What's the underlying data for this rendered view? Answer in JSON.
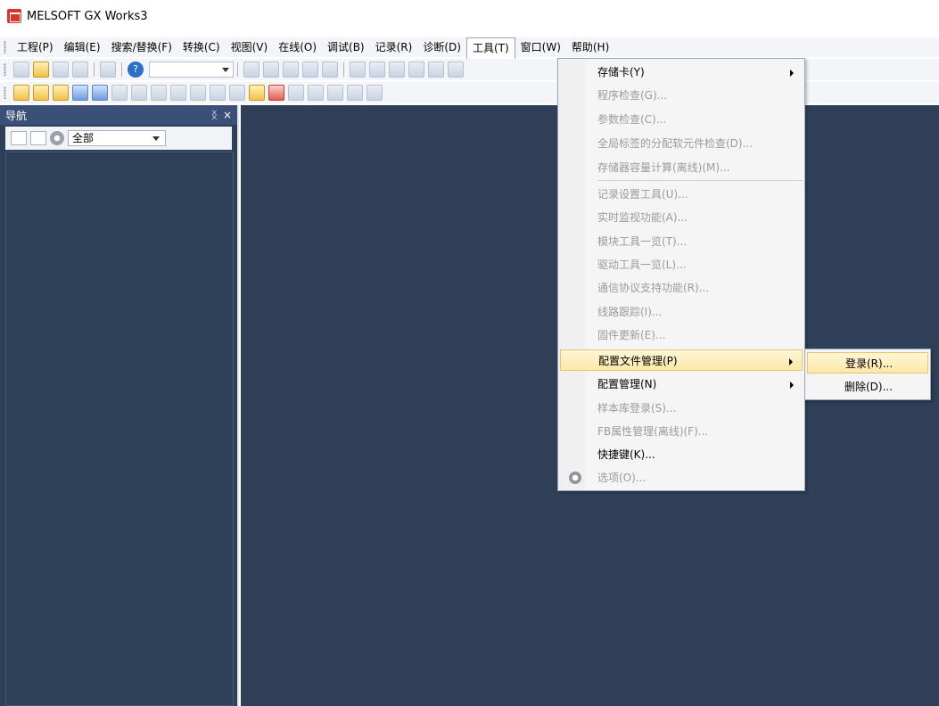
{
  "window": {
    "title": "MELSOFT GX Works3"
  },
  "menubar": {
    "items": [
      "工程(P)",
      "编辑(E)",
      "搜索/替换(F)",
      "转换(C)",
      "视图(V)",
      "在线(O)",
      "调试(B)",
      "记录(R)",
      "诊断(D)",
      "工具(T)",
      "窗口(W)",
      "帮助(H)"
    ],
    "active": "工具(T)"
  },
  "nav": {
    "title": "导航",
    "pin": "ᛝ",
    "close": "×",
    "filter_value": "全部"
  },
  "tools_menu": {
    "items": [
      {
        "label": "存储卡(Y)",
        "enabled": true,
        "submenu": true
      },
      {
        "label": "程序检查(G)...",
        "enabled": false
      },
      {
        "label": "参数检查(C)...",
        "enabled": false
      },
      {
        "label": "全局标签的分配软元件检查(D)...",
        "enabled": false
      },
      {
        "label": "存储器容量计算(离线)(M)...",
        "enabled": false
      },
      {
        "label": "记录设置工具(U)...",
        "enabled": false
      },
      {
        "label": "实时监视功能(A)...",
        "enabled": false
      },
      {
        "label": "模块工具一览(T)...",
        "enabled": false
      },
      {
        "label": "驱动工具一览(L)...",
        "enabled": false
      },
      {
        "label": "通信协议支持功能(R)...",
        "enabled": false
      },
      {
        "label": "线路跟踪(I)...",
        "enabled": false
      },
      {
        "label": "固件更新(E)...",
        "enabled": false
      },
      {
        "label": "配置文件管理(P)",
        "enabled": true,
        "submenu": true,
        "highlight": true
      },
      {
        "label": "配置管理(N)",
        "enabled": true,
        "submenu": true
      },
      {
        "label": "样本库登录(S)...",
        "enabled": false
      },
      {
        "label": "FB属性管理(离线)(F)...",
        "enabled": false
      },
      {
        "label": "快捷键(K)...",
        "enabled": true
      },
      {
        "label": "选项(O)...",
        "enabled": false
      }
    ]
  },
  "submenu": {
    "items": [
      {
        "label": "登录(R)...",
        "highlight": true
      },
      {
        "label": "删除(D)..."
      }
    ]
  },
  "colors": {
    "workspace": "#2f3f58",
    "highlight": "#fde8a7",
    "nav_header": "#3a5077"
  }
}
